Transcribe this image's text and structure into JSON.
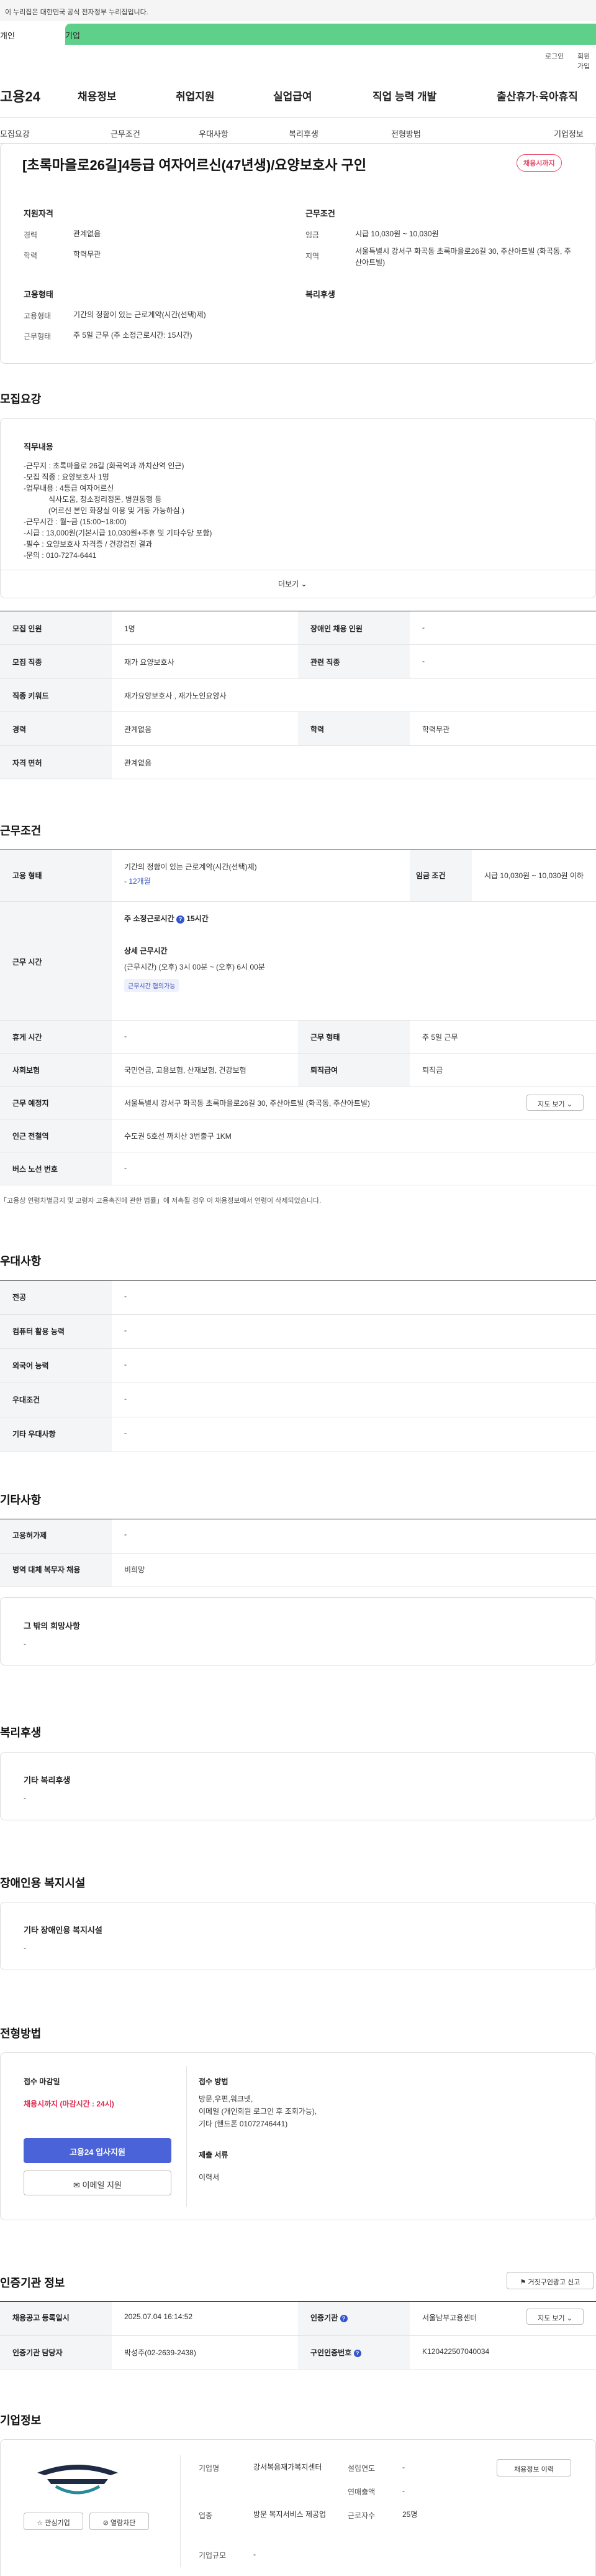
{
  "gov_banner": "이 누리집은 대한민국 공식 전자정부 누리집입니다.",
  "tabs": [
    "개인",
    "기업"
  ],
  "util": {
    "login": "로그인",
    "join": "회원가입"
  },
  "logo": "고용24",
  "gnb": [
    "채용정보",
    "취업지원",
    "실업급여",
    "직업 능력 개발",
    "출산휴가·육아휴직"
  ],
  "snb": [
    "모집요강",
    "근무조건",
    "우대사항",
    "복리후생",
    "전형방법",
    "기업정보"
  ],
  "header": {
    "title": "[초록마을로26길]4등급 여자어르신(47년생)/요양보호사 구인",
    "badge": "채용시까지"
  },
  "summary": {
    "qual_title": "지원자격",
    "career_k": "경력",
    "career_v": "관계없음",
    "edu_k": "학력",
    "edu_v": "학력무관",
    "cond_title": "근무조건",
    "wage_k": "임금",
    "wage_v": "시급 10,030원 ~ 10,030원",
    "loc_k": "지역",
    "loc_v": "서울특별시 강서구 화곡동 초록마을로26길 30, 주산아트빌 (화곡동, 주산아트빌)",
    "emp_title": "고용형태",
    "emptype_k": "고용형태",
    "emptype_v": "기간의 정함이 있는 근로계약(시간(선택)제)",
    "workday_k": "근무형태",
    "workday_v": "주 5일 근무 (주 소정근로시간: 15시간)",
    "welfare_title": "복리후생"
  },
  "recruit": {
    "section_title": "모집요강",
    "job_title": "직무내용",
    "job_lines": [
      "-근무지 : 초록마을로 26길 (화곡역과 까치산역 인근)",
      "-모집 직종 : 요양보호사 1명",
      "-업무내용 : 4등급 여자어르신",
      "            식사도움, 청소정리정돈, 병원동행 등",
      "            (어르신 본인 화장실 이용 및 거동 가능하심.)",
      "-근무시간 : 월~금 (15:00~18:00)",
      "-시급 : 13,000원(기본시급 10,030원+주휴 및 기타수당 포함)",
      "-필수 : 요양보호사 자격증 / 건강검진 결과",
      "-문의 : 010-7274-6441"
    ],
    "more": "더보기",
    "rows": [
      {
        "k1": "모집 인원",
        "v1": "1명",
        "k2": "장애인 채용 인원",
        "v2": "-"
      },
      {
        "k1": "모집 직종",
        "v1": "재가 요양보호사",
        "k2": "관련 직종",
        "v2": "-"
      },
      {
        "k1": "직종 키워드",
        "v1": "재가요양보호사 , 재가노인요양사"
      },
      {
        "k1": "경력",
        "v1": "관계없음",
        "k2": "학력",
        "v2": "학력무관"
      },
      {
        "k1": "자격 면허",
        "v1": "관계없음"
      }
    ]
  },
  "work": {
    "section_title": "근무조건",
    "emp_k": "고용 형태",
    "emp_v": "기간의 정함이 있는 근로계약(시간(선택)제)",
    "emp_months": "- 12개월",
    "wage_k": "임금 조건",
    "wage_v": "시급 10,030원 ~ 10,030원 이하",
    "time_k": "근무 시간",
    "weekly": "주 소정근로시간",
    "weekly_v": "15시간",
    "detail_title": "상세 근무시간",
    "detail_v": "(근무시간) (오후) 3시 00분 ~ (오후) 6시 00분",
    "detail_pill": "근무시간 협의가능",
    "rest_k": "휴게 시간",
    "rest_v": "-",
    "form_k": "근무 형태",
    "form_v": "주 5일 근무",
    "ins_k": "사회보험",
    "ins_v": "국민연금, 고용보험, 산재보험, 건강보험",
    "retire_k": "퇴직급여",
    "retire_v": "퇴직금",
    "place_k": "근무 예정지",
    "place_v": "서울특별시 강서구 화곡동 초록마을로26길 30, 주산아트빌 (화곡동, 주산아트빌)",
    "map_btn": "지도 보기",
    "subway_k": "인근 전철역",
    "subway_v": "수도권 5호선 까치산 3번출구 1KM",
    "bus_k": "버스 노선 번호",
    "bus_v": "-",
    "note": "「고용상 연령차별금지 및 고령자 고용촉진에 관한 법률」에 저촉될 경우 이 채용정보에서 연령이 삭제되었습니다."
  },
  "pref": {
    "section_title": "우대사항",
    "rows": [
      {
        "k": "전공",
        "v": "-"
      },
      {
        "k": "컴퓨터 활용 능력",
        "v": "-"
      },
      {
        "k": "외국어 능력",
        "v": "-"
      },
      {
        "k": "우대조건",
        "v": "-"
      },
      {
        "k": "기타 우대사항",
        "v": "-"
      }
    ]
  },
  "etc": {
    "section_title": "기타사항",
    "rows": [
      {
        "k": "고용허가제",
        "v": "-"
      },
      {
        "k": "병역 대체 복무자 채용",
        "v": "비희망"
      }
    ],
    "hope_title": "그 밖의 희망사항",
    "hope_v": "-"
  },
  "welfare": {
    "section_title": "복리후생",
    "box_title": "기타 복리후생",
    "box_v": "-"
  },
  "disabled": {
    "section_title": "장애인용 복지시설",
    "box_title": "기타 장애인용 복지시설",
    "box_v": "-"
  },
  "screen": {
    "section_title": "전형방법",
    "deadline_k": "접수 마감일",
    "deadline_v": "채용시까지 (마감시간 : 24시)",
    "apply_btn": "고용24 입사지원",
    "email_btn": "이메일 지원",
    "method_k": "접수 방법",
    "method_v": "방문,우편,워크넷,",
    "method_v2": "이메일 (개인회원 로그인 후 조회가능),",
    "method_v3": "기타 (핸드폰 01072746441)",
    "docs_k": "제출 서류",
    "docs_v": "이력서"
  },
  "agency": {
    "section_title": "인증기관 정보",
    "report_btn": "거짓구인광고 신고",
    "reg_k": "채용공고 등록일시",
    "reg_v": "2025.07.04 16:14:52",
    "org_k": "인증기관",
    "org_v": "서울남부고용센터",
    "map_btn": "지도 보기",
    "mgr_k": "인증기관 담당자",
    "mgr_v": "박성주(02-2639-2438)",
    "no_k": "구인인증번호",
    "no_v": "K120422507040034"
  },
  "company": {
    "section_title": "기업정보",
    "fav": "관심기업",
    "block": "열람차단",
    "name_k": "기업명",
    "name_v": "강서복음재가복지센터",
    "ind_k": "업종",
    "ind_v": "방문 복지서비스 제공업",
    "size_k": "기업규모",
    "size_v": "-",
    "est_k": "설립연도",
    "est_v": "-",
    "sales_k": "연매출액",
    "sales_v": "-",
    "emp_k": "근로자수",
    "emp_v": "25명",
    "jobs_btn": "채용정보 이력"
  }
}
